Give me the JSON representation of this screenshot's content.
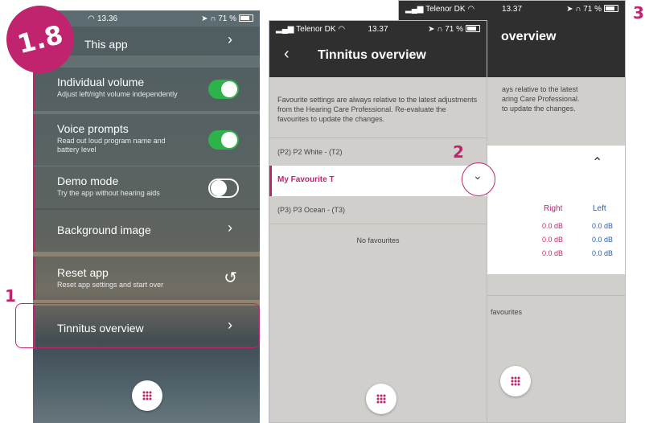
{
  "badge": "1.8",
  "markers": {
    "one": "1",
    "two": "2",
    "three": "3"
  },
  "phone1": {
    "status": {
      "carrier": "",
      "time": "13.36",
      "battery": "71 %"
    },
    "rows": {
      "this_app": {
        "label": "This app"
      },
      "individual_volume": {
        "label": "Individual volume",
        "sub": "Adjust left/right volume independently",
        "on": true
      },
      "voice_prompts": {
        "label": "Voice prompts",
        "sub": "Read out loud program name and battery level",
        "on": true
      },
      "demo_mode": {
        "label": "Demo mode",
        "sub": "Try the app without hearing aids",
        "on": false
      },
      "background_image": {
        "label": "Background image"
      },
      "reset_app": {
        "label": "Reset app",
        "sub": "Reset app settings and start over"
      },
      "tinnitus_overview": {
        "label": "Tinnitus overview"
      }
    }
  },
  "phone2": {
    "status": {
      "carrier": "Telenor DK",
      "time": "13.37",
      "battery": "71 %"
    },
    "title": "Tinnitus overview",
    "note": "Favourite settings are always relative to the latest adjustments from the Hearing Care Professional. Re-evaluate the favourites to update the changes.",
    "programs": [
      {
        "label": "(P2) P2 White - (T2)"
      },
      {
        "label": "My Favourite T"
      },
      {
        "label": "(P3) P3 Ocean - (T3)"
      }
    ],
    "empty": "No favourites"
  },
  "phone3": {
    "status": {
      "carrier": "Telenor DK",
      "time": "13.37",
      "battery": "71 %"
    },
    "title": "overview",
    "note_lines": [
      "ays relative to the latest",
      "aring Care Professional.",
      "to update the changes."
    ],
    "columns": {
      "right": "Right",
      "left": "Left"
    },
    "rows": [
      {
        "right": "0.0 dB",
        "left": "0.0 dB"
      },
      {
        "right": "0.0 dB",
        "left": "0.0 dB"
      },
      {
        "right": "0.0 dB",
        "left": "0.0 dB"
      }
    ],
    "favourites": "favourites"
  },
  "colors": {
    "accent": "#c0246e",
    "toggle_on": "#2db34a",
    "header": "#2f2f2f",
    "panel": "#d1cfcc",
    "db_left": "#2a5db0"
  }
}
